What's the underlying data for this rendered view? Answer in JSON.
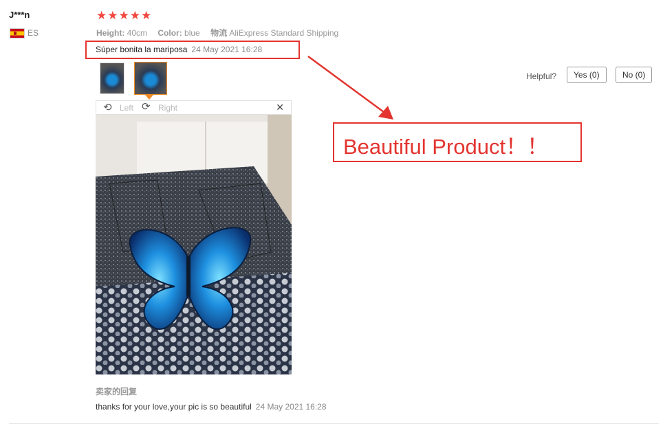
{
  "reviewer": {
    "name": "J***n",
    "country": "ES"
  },
  "rating": {
    "stars_text": "★★★★★",
    "value": 5,
    "max": 5,
    "color": "#f0473f"
  },
  "attributes": {
    "height_label": "Height:",
    "height_value": "40cm",
    "color_label": "Color:",
    "color_value": "blue",
    "shipping_label": "物流",
    "shipping_value": "AliExpress Standard Shipping"
  },
  "review": {
    "text": "Súper bonita la mariposa",
    "date": "24 May 2021 16:28"
  },
  "viewer": {
    "left_label": "Left",
    "right_label": "Right",
    "rotate_left_icon": "rotate-left-icon",
    "rotate_right_icon": "rotate-right-icon",
    "close_icon": "close-icon",
    "close_glyph": "✕"
  },
  "helpful": {
    "label": "Helpful?",
    "yes_label": "Yes (0)",
    "no_label": "No (0)"
  },
  "annotation": {
    "text": "Beautiful Product！！",
    "color": "#e3342f"
  },
  "seller_reply": {
    "label": "卖家的回复",
    "text": "thanks for your love,your pic is so beautiful",
    "date": "24 May 2021 16:28"
  }
}
